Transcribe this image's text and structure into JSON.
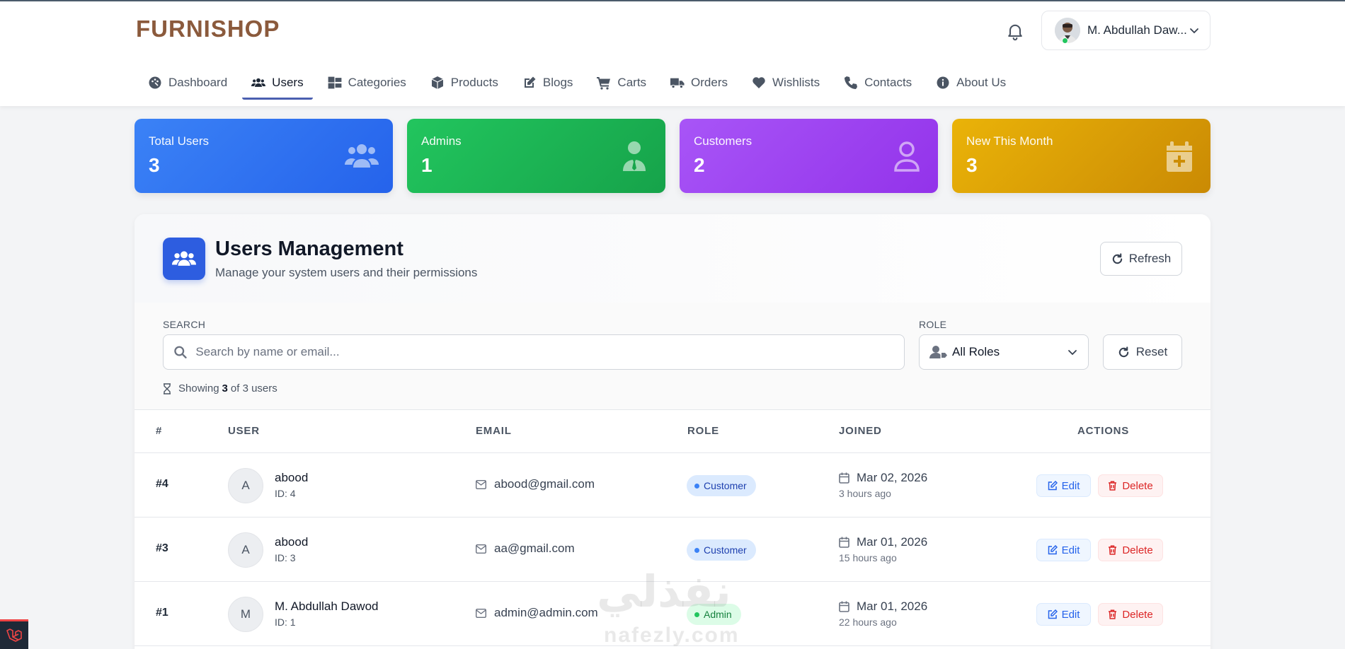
{
  "brand": {
    "logo": "FURNISHOP",
    "color": "#8b5a3c"
  },
  "user_menu": {
    "name": "M. Abdullah Daw...",
    "status": "online"
  },
  "nav": {
    "items": [
      {
        "label": "Dashboard",
        "icon": "palette-icon",
        "active": false
      },
      {
        "label": "Users",
        "icon": "users-icon",
        "active": true
      },
      {
        "label": "Categories",
        "icon": "categories-icon",
        "active": false
      },
      {
        "label": "Products",
        "icon": "box-icon",
        "active": false
      },
      {
        "label": "Blogs",
        "icon": "edit-icon",
        "active": false
      },
      {
        "label": "Carts",
        "icon": "cart-icon",
        "active": false
      },
      {
        "label": "Orders",
        "icon": "truck-icon",
        "active": false
      },
      {
        "label": "Wishlists",
        "icon": "heart-icon",
        "active": false
      },
      {
        "label": "Contacts",
        "icon": "phone-icon",
        "active": false
      },
      {
        "label": "About Us",
        "icon": "info-icon",
        "active": false
      }
    ]
  },
  "stats": [
    {
      "label": "Total Users",
      "value": "3",
      "icon": "users-icon",
      "color": "#3b82f6"
    },
    {
      "label": "Admins",
      "value": "1",
      "icon": "user-tie-icon",
      "color": "#22c55e"
    },
    {
      "label": "Customers",
      "value": "2",
      "icon": "user-icon",
      "color": "#a855f7"
    },
    {
      "label": "New This Month",
      "value": "3",
      "icon": "calendar-plus-icon",
      "color": "#eab308"
    }
  ],
  "panel": {
    "title": "Users Management",
    "subtitle": "Manage your system users and their permissions",
    "refresh_label": "Refresh"
  },
  "filters": {
    "search_label": "SEARCH",
    "search_placeholder": "Search by name or email...",
    "role_label": "ROLE",
    "role_value": "All Roles",
    "reset_label": "Reset",
    "showing_prefix": "Showing",
    "showing_count": "3",
    "showing_suffix": "of 3 users"
  },
  "table": {
    "columns": [
      "#",
      "USER",
      "EMAIL",
      "ROLE",
      "JOINED",
      "ACTIONS"
    ],
    "rows": [
      {
        "id": "#4",
        "initial": "A",
        "name": "abood",
        "sub": "ID: 4",
        "email": "abood@gmail.com",
        "role": "Customer",
        "date": "Mar 02, 2026",
        "ago": "3 hours ago",
        "edit": "Edit",
        "delete": "Delete"
      },
      {
        "id": "#3",
        "initial": "A",
        "name": "abood",
        "sub": "ID: 3",
        "email": "aa@gmail.com",
        "role": "Customer",
        "date": "Mar 01, 2026",
        "ago": "15 hours ago",
        "edit": "Edit",
        "delete": "Delete"
      },
      {
        "id": "#1",
        "initial": "M",
        "name": "M. Abdullah Dawod",
        "sub": "ID: 1",
        "email": "admin@admin.com",
        "role": "Admin",
        "date": "Mar 01, 2026",
        "ago": "22 hours ago",
        "edit": "Edit",
        "delete": "Delete"
      }
    ]
  },
  "watermark": {
    "arabic": "نفذلي",
    "latin": "nafezly.com"
  }
}
